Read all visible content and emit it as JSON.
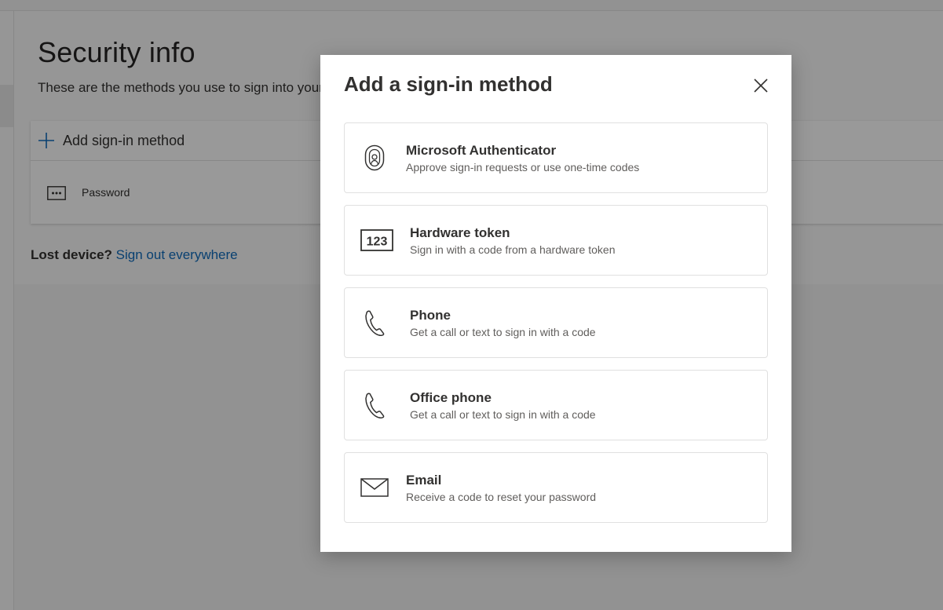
{
  "page": {
    "title": "Security info",
    "description": "These are the methods you use to sign into your account or reset your password.",
    "add_method_label": "Add sign-in method",
    "methods": [
      {
        "label": "Password",
        "icon": "password-dots-icon"
      }
    ],
    "lost_device_question": "Lost device?",
    "lost_device_link": "Sign out everywhere"
  },
  "modal": {
    "title": "Add a sign-in method",
    "close_icon": "close-icon",
    "options": [
      {
        "id": "microsoft-authenticator",
        "title": "Microsoft Authenticator",
        "subtitle": "Approve sign-in requests or use one-time codes",
        "icon": "authenticator-icon"
      },
      {
        "id": "hardware-token",
        "title": "Hardware token",
        "subtitle": "Sign in with a code from a hardware token",
        "icon": "hardware-token-123-icon"
      },
      {
        "id": "phone",
        "title": "Phone",
        "subtitle": "Get a call or text to sign in with a code",
        "icon": "phone-icon"
      },
      {
        "id": "office-phone",
        "title": "Office phone",
        "subtitle": "Get a call or text to sign in with a code",
        "icon": "phone-icon"
      },
      {
        "id": "email",
        "title": "Email",
        "subtitle": "Receive a code to reset your password",
        "icon": "envelope-icon"
      }
    ]
  },
  "colors": {
    "link": "#0f6cbd",
    "accent_plus": "#0f6cbd",
    "text": "#323130",
    "subtext": "#605e5c"
  }
}
